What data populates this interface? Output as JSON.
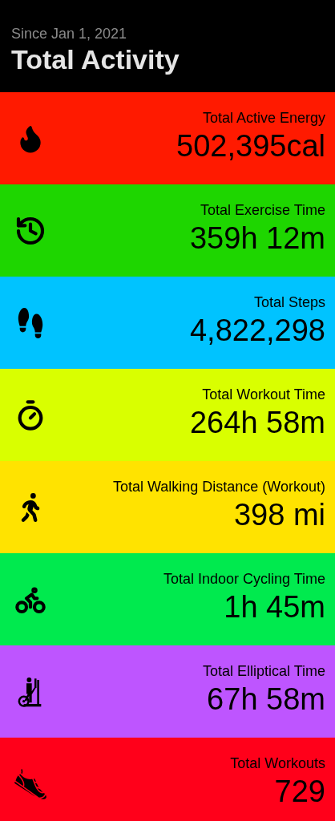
{
  "header": {
    "subtitle": "Since Jan 1, 2021",
    "title": "Total Activity"
  },
  "cards": [
    {
      "kind": "energy",
      "label": "Total Active Energy",
      "value": "502,395cal",
      "color": "#ff1a00"
    },
    {
      "kind": "exercise",
      "label": "Total Exercise Time",
      "value": "359h 12m",
      "color": "#1ed600"
    },
    {
      "kind": "steps",
      "label": "Total Steps",
      "value": "4,822,298",
      "color": "#00c3ff"
    },
    {
      "kind": "workout_time",
      "label": "Total Workout Time",
      "value": "264h 58m",
      "color": "#d9ff00"
    },
    {
      "kind": "walking",
      "label": "Total Walking Distance (Workout)",
      "value": "398 mi",
      "color": "#ffe300"
    },
    {
      "kind": "cycling",
      "label": "Total Indoor Cycling Time",
      "value": "1h 45m",
      "color": "#00ea4e"
    },
    {
      "kind": "elliptical",
      "label": "Total Elliptical Time",
      "value": "67h 58m",
      "color": "#be55ff"
    },
    {
      "kind": "workouts",
      "label": "Total Workouts",
      "value": "729",
      "color": "#ff001a"
    }
  ]
}
